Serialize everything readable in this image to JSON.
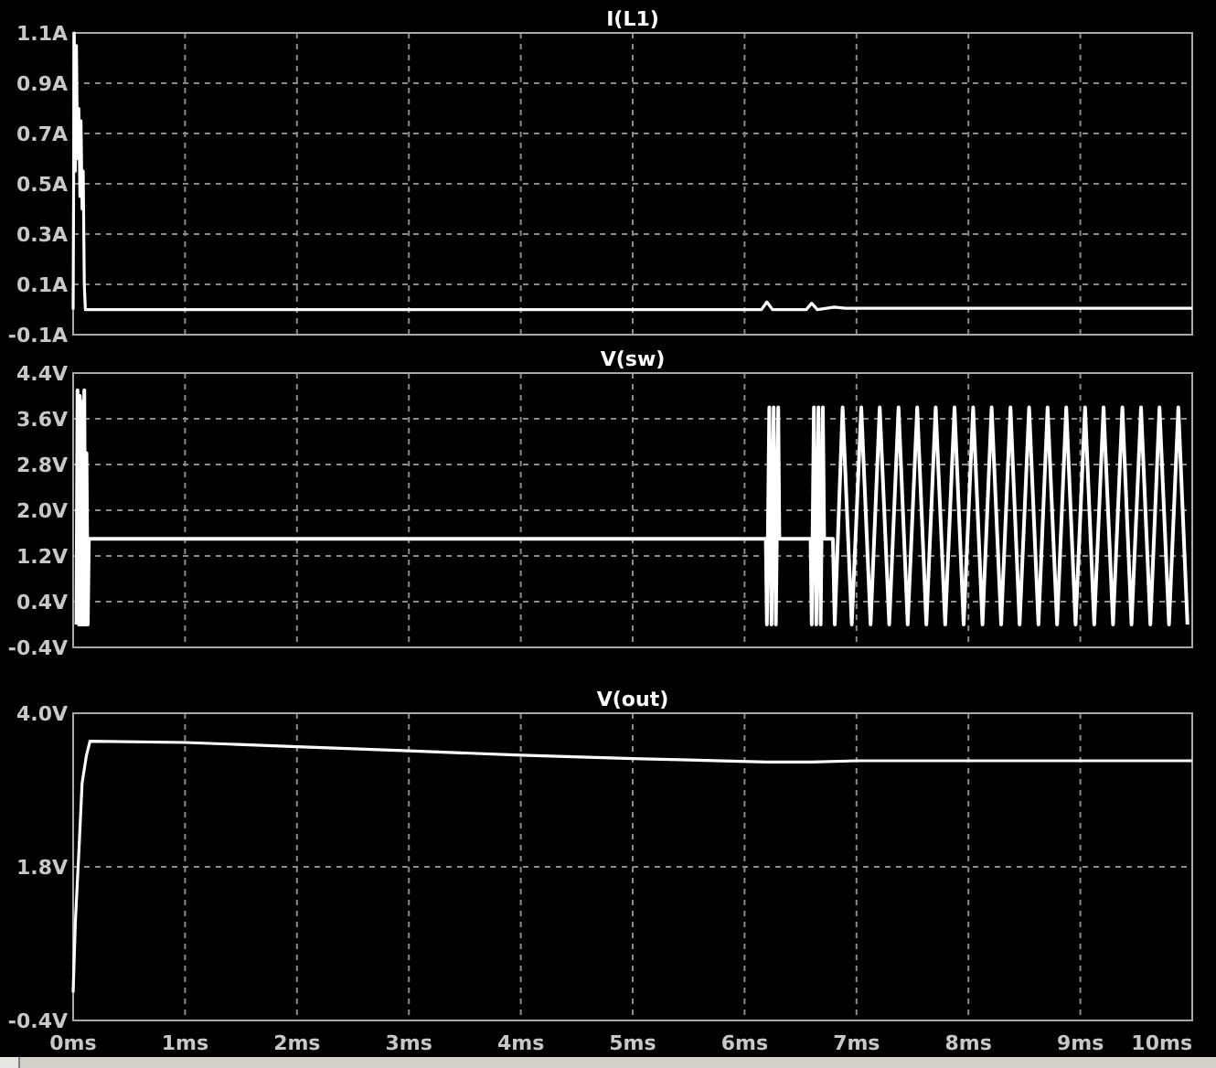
{
  "charts": [
    {
      "chart_data": {
        "type": "line",
        "grid": true,
        "xlim": [
          0,
          10
        ],
        "ylim": [
          -0.1,
          1.1
        ],
        "yticks": [
          {
            "value": 1.1,
            "label": "1.1A"
          },
          {
            "value": 0.9,
            "label": "0.9A"
          },
          {
            "value": 0.7,
            "label": "0.7A"
          },
          {
            "value": 0.5,
            "label": "0.5A"
          },
          {
            "value": 0.3,
            "label": "0.3A"
          },
          {
            "value": 0.1,
            "label": "0.1A"
          },
          {
            "value": -0.1,
            "label": "-0.1A"
          }
        ],
        "x": [
          0,
          0.01,
          0.02,
          0.03,
          0.04,
          0.05,
          0.06,
          0.07,
          0.08,
          0.09,
          0.1,
          0.11,
          6.15,
          6.2,
          6.25,
          6.55,
          6.6,
          6.65,
          6.8,
          6.9,
          10
        ],
        "series": [
          {
            "name": "I(L1)",
            "color": "#ffffff",
            "values": [
              0,
              1.1,
              0.55,
              1.05,
              0.6,
              0.8,
              0.45,
              0.75,
              0.4,
              0.55,
              0.1,
              0.0,
              0.0,
              0.03,
              0.0,
              0.0,
              0.025,
              0.0,
              0.01,
              0.005,
              0.005
            ]
          }
        ]
      }
    },
    {
      "chart_data": {
        "type": "line",
        "grid": true,
        "xlim": [
          0,
          10
        ],
        "ylim": [
          -0.4,
          4.4
        ],
        "yticks": [
          {
            "value": 4.4,
            "label": "4.4V"
          },
          {
            "value": 3.6,
            "label": "3.6V"
          },
          {
            "value": 2.8,
            "label": "2.8V"
          },
          {
            "value": 2.0,
            "label": "2.0V"
          },
          {
            "value": 1.2,
            "label": "1.2V"
          },
          {
            "value": 0.4,
            "label": "0.4V"
          },
          {
            "value": -0.4,
            "label": "-0.4V"
          }
        ],
        "x": [
          0.03,
          0.04,
          0.05,
          0.06,
          0.07,
          0.08,
          0.09,
          0.1,
          0.11,
          0.12,
          0.13,
          0.14,
          6.19,
          6.2,
          6.22,
          6.24,
          6.26,
          6.28,
          6.3,
          6.31,
          6.59,
          6.6,
          6.62,
          6.64,
          6.66,
          6.68,
          6.7,
          6.71,
          6.79,
          6.805,
          6.875,
          6.958,
          7.042,
          7.125,
          7.208,
          7.292,
          7.375,
          7.458,
          7.542,
          7.625,
          7.708,
          7.792,
          7.875,
          7.958,
          8.042,
          8.125,
          8.208,
          8.292,
          8.375,
          8.458,
          8.542,
          8.625,
          8.708,
          8.792,
          8.875,
          8.958,
          9.042,
          9.125,
          9.208,
          9.292,
          9.375,
          9.458,
          9.542,
          9.625,
          9.708,
          9.792,
          9.875,
          9.958
        ],
        "series": [
          {
            "name": "V(sw)",
            "color": "#ffffff",
            "values": [
              0,
              4.1,
              0,
              4.0,
              0,
              3.9,
              0,
              4.1,
              0,
              3.0,
              0,
              1.5,
              1.5,
              0,
              3.8,
              0,
              3.8,
              0,
              3.8,
              1.5,
              1.5,
              0,
              3.8,
              0,
              3.8,
              0,
              3.8,
              1.5,
              1.5,
              0,
              3.8,
              0,
              3.8,
              0,
              3.8,
              0,
              3.8,
              0,
              3.8,
              0,
              3.8,
              0,
              3.8,
              0,
              3.8,
              0,
              3.8,
              0,
              3.8,
              0,
              3.8,
              0,
              3.8,
              0,
              3.8,
              0,
              3.8,
              0,
              3.8,
              0,
              3.8,
              0,
              3.8,
              0,
              3.8,
              0,
              3.8,
              0
            ]
          }
        ]
      }
    },
    {
      "chart_data": {
        "type": "line",
        "grid": true,
        "xlim": [
          0,
          10
        ],
        "ylim": [
          -0.4,
          4.0
        ],
        "xticks": [
          {
            "value": 0,
            "label": "0ms"
          },
          {
            "value": 1,
            "label": "1ms"
          },
          {
            "value": 2,
            "label": "2ms"
          },
          {
            "value": 3,
            "label": "3ms"
          },
          {
            "value": 4,
            "label": "4ms"
          },
          {
            "value": 5,
            "label": "5ms"
          },
          {
            "value": 6,
            "label": "6ms"
          },
          {
            "value": 7,
            "label": "7ms"
          },
          {
            "value": 8,
            "label": "8ms"
          },
          {
            "value": 9,
            "label": "9ms"
          },
          {
            "value": 10,
            "label": "10ms"
          }
        ],
        "yticks": [
          {
            "value": 4.0,
            "label": "4.0V"
          },
          {
            "value": 1.8,
            "label": "1.8V"
          },
          {
            "value": -0.4,
            "label": "-0.4V"
          }
        ],
        "x": [
          0,
          0.02,
          0.05,
          0.08,
          0.12,
          0.15,
          1,
          2,
          3,
          4,
          5,
          6.2,
          6.6,
          7,
          10
        ],
        "series": [
          {
            "name": "V(out)",
            "color": "#ffffff",
            "values": [
              0,
              1.0,
              2.0,
              3.0,
              3.4,
              3.6,
              3.58,
              3.52,
              3.46,
              3.4,
              3.35,
              3.3,
              3.3,
              3.32,
              3.32
            ]
          }
        ]
      }
    }
  ]
}
